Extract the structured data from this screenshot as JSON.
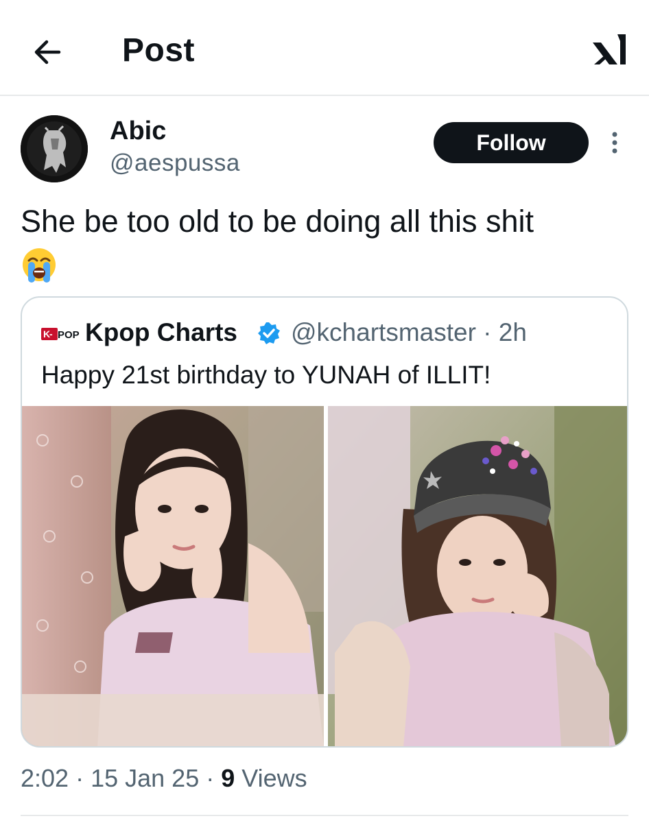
{
  "header": {
    "title": "Post",
    "back_icon": "arrow-left-icon",
    "brand_icon": "x-logo-icon"
  },
  "author": {
    "display_name": "Abic",
    "handle": "@aespussa",
    "follow_label": "Follow"
  },
  "post": {
    "text": "She be too old to be doing all this shit",
    "emoji": "loudly-crying-face"
  },
  "quoted_post": {
    "source_logo": "K-POP",
    "name": "Kpop Charts",
    "verified": true,
    "handle": "@kchartsmaster",
    "time": "2h",
    "text": "Happy 21st birthday to YUNAH of ILLIT!"
  },
  "meta": {
    "time": "2:02",
    "date": "15 Jan 25",
    "views_count": "9",
    "views_label": "Views"
  },
  "colors": {
    "accent_verified": "#1d9bf0",
    "follow_bg": "#0f1419",
    "muted": "#536471",
    "border": "#cfd9de"
  }
}
